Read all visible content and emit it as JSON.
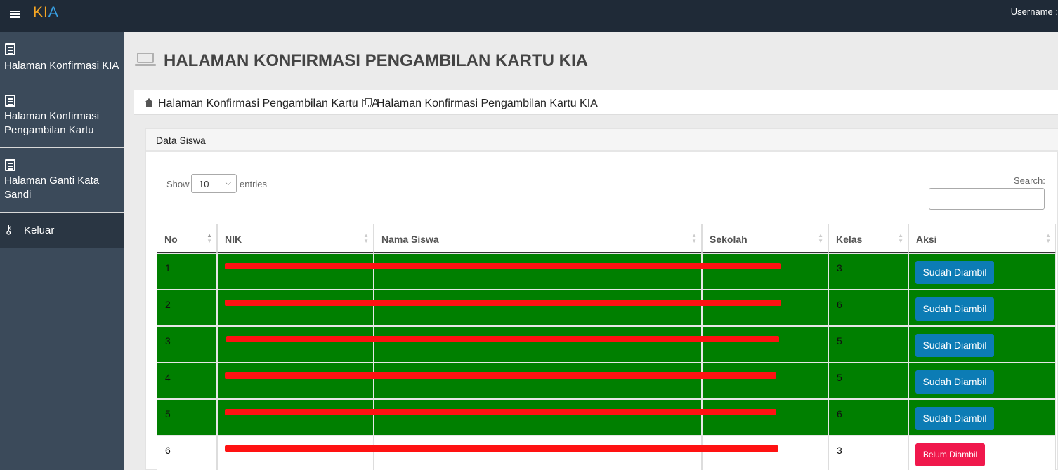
{
  "app": {
    "brand_k": "K",
    "brand_i": "I",
    "brand_a": "A",
    "username_label": "Username :"
  },
  "sidebar": {
    "items": [
      {
        "label": "Halaman Konfirmasi KIA"
      },
      {
        "label": "Halaman Konfirmasi Pengambilan Kartu"
      },
      {
        "label": "Halaman Ganti Kata Sandi"
      },
      {
        "label": "Keluar"
      }
    ]
  },
  "page": {
    "title": "HALAMAN KONFIRMASI PENGAMBILAN KARTU KIA"
  },
  "breadcrumb": {
    "items": [
      {
        "label": "Halaman Konfirmasi Pengambilan Kartu KIA"
      },
      {
        "label": "Halaman Konfirmasi Pengambilan Kartu KIA"
      }
    ],
    "separator": "/"
  },
  "panel": {
    "title": "Data Siswa"
  },
  "controls": {
    "show_label": "Show",
    "entries_value": "10",
    "entries_label": "entries",
    "search_label": "Search:"
  },
  "table": {
    "columns": [
      {
        "label": "No"
      },
      {
        "label": "NIK"
      },
      {
        "label": "Nama Siswa"
      },
      {
        "label": "Sekolah"
      },
      {
        "label": "Kelas"
      },
      {
        "label": "Aksi"
      }
    ],
    "rows": [
      {
        "no": "1",
        "kelas": "3",
        "action": "Sudah Diambil",
        "status": "taken"
      },
      {
        "no": "2",
        "kelas": "6",
        "action": "Sudah Diambil",
        "status": "taken"
      },
      {
        "no": "3",
        "kelas": "5",
        "action": "Sudah Diambil",
        "status": "taken"
      },
      {
        "no": "4",
        "kelas": "5",
        "action": "Sudah Diambil",
        "status": "taken"
      },
      {
        "no": "5",
        "kelas": "6",
        "action": "Sudah Diambil",
        "status": "taken"
      },
      {
        "no": "6",
        "kelas": "3",
        "action": "Belum Diambil",
        "status": "not_taken"
      }
    ]
  },
  "colors": {
    "topbar": "#1f2a37",
    "sidebar": "#3b4a5a",
    "taken_row": "#007f00",
    "taken_button": "#0c7cb5",
    "not_taken_button": "#f0184c",
    "redaction": "#ff1212"
  },
  "icons": {
    "menu": "hamburger-icon",
    "sidebar_doc": "document-icon",
    "logout": "key-icon",
    "page_head": "laptop-icon",
    "crumb_home": "home-icon",
    "crumb_page": "copy-icon"
  }
}
